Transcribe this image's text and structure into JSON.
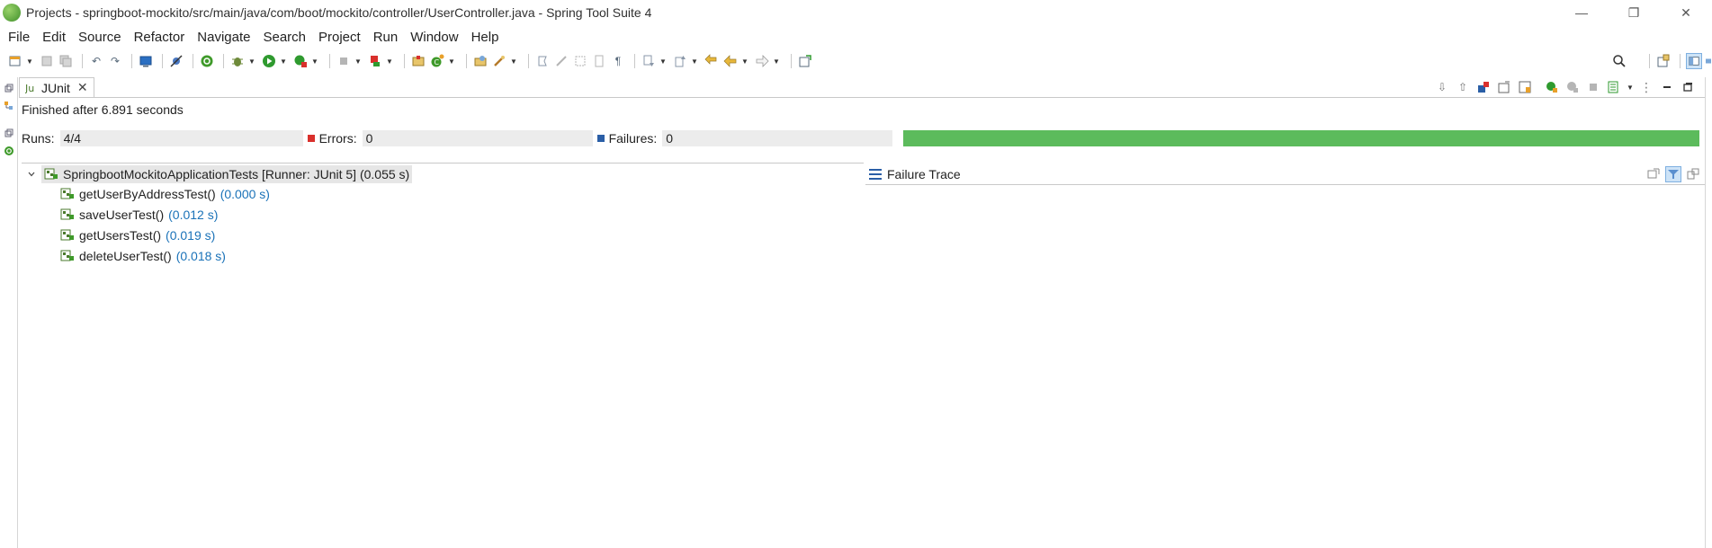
{
  "window": {
    "title": "Projects - springboot-mockito/src/main/java/com/boot/mockito/controller/UserController.java - Spring Tool Suite 4",
    "controls": [
      "—",
      "❐",
      "✕"
    ]
  },
  "menu": [
    "File",
    "Edit",
    "Source",
    "Refactor",
    "Navigate",
    "Search",
    "Project",
    "Run",
    "Window",
    "Help"
  ],
  "view": {
    "tab_label": "JUnit",
    "close_glyph": "✕",
    "status": "Finished after 6.891 seconds",
    "counters": {
      "runs_label": "Runs:",
      "runs_value": "4/4",
      "errors_label": "Errors:",
      "errors_value": "0",
      "failures_label": "Failures:",
      "failures_value": "0"
    },
    "progress_fraction": 1.0,
    "tree": {
      "root_label": "SpringbootMockitoApplicationTests [Runner: JUnit 5] (0.055 s)",
      "children": [
        {
          "name": "getUserByAddressTest()",
          "time": "(0.000 s)"
        },
        {
          "name": "saveUserTest()",
          "time": "(0.012 s)"
        },
        {
          "name": "getUsersTest()",
          "time": "(0.019 s)"
        },
        {
          "name": "deleteUserTest()",
          "time": "(0.018 s)"
        }
      ]
    },
    "failure_trace_label": "Failure Trace"
  },
  "colors": {
    "progress_green": "#5cbb5c",
    "time_blue": "#1a72b8",
    "error_red": "#d9302c",
    "failure_blue": "#2a5ea6"
  },
  "icons": {
    "toolbar": [
      "new-icon",
      "save-icon",
      "save-all-icon",
      "undo-icon",
      "redo-icon",
      "terminal-icon",
      "skip-breakpoints-icon",
      "spring-boot-icon",
      "debug-icon",
      "run-icon",
      "coverage-icon",
      "stop-icon",
      "external-tools-icon",
      "new-java-package-icon",
      "new-class-icon",
      "open-type-icon",
      "search-tool-icon",
      "toggle-mark-icon",
      "edit-icon",
      "block-select-icon",
      "whitespace-icon",
      "next-annotation-icon",
      "prev-annotation-icon",
      "last-edit-icon",
      "back-icon",
      "forward-icon",
      "pin-editor-icon"
    ],
    "toolbar_right": [
      "search-icon",
      "open-perspective-icon",
      "java-perspective-icon"
    ],
    "view_toolbar": [
      "next-failure-icon",
      "previous-failure-icon",
      "failures-only-icon",
      "skipped-icon",
      "scroll-lock-icon",
      "rerun-icon",
      "rerun-failed-icon",
      "stop-run-icon",
      "history-icon",
      "view-menu-icon",
      "minimize-icon",
      "maximize-icon"
    ]
  }
}
